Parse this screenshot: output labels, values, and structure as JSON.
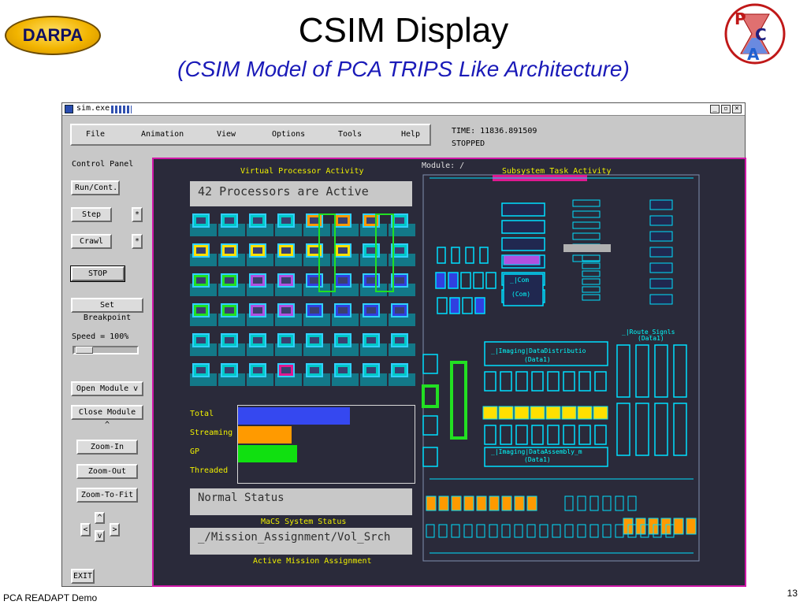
{
  "slide": {
    "darpa_logo_text": "DARPA",
    "title": "CSIM Display",
    "subtitle": "(CSIM Model of PCA TRIPS Like Architecture)",
    "footer": "PCA READAPT Demo",
    "page_number": "13",
    "pca_logo_letters": [
      "P",
      "C",
      "A"
    ]
  },
  "window": {
    "title": "sim.exe",
    "controls": [
      "_",
      "▫",
      "×"
    ]
  },
  "menu": {
    "items": [
      "File",
      "Animation",
      "View",
      "Options",
      "Tools",
      "Help"
    ]
  },
  "sim_status": {
    "time_line": "TIME: 11836.891509",
    "state": "STOPPED"
  },
  "control_panel": {
    "label": "Control Panel",
    "run": "Run/Cont.",
    "step": "Step",
    "step_mark": "*",
    "crawl": "Crawl",
    "crawl_mark": "*",
    "stop": "STOP",
    "set_breakpoint": "Set Breakpoint",
    "speed_label": "Speed = 100%",
    "speed_value": 100,
    "open_module": "Open Module  v",
    "close_module": "Close Module ^",
    "zoom_in": "Zoom-In",
    "zoom_out": "Zoom-Out",
    "zoom_to_fit": "Zoom-To-Fit",
    "arrow_up": "^",
    "arrow_left": "<",
    "arrow_down": "v",
    "arrow_right": ">",
    "exit": "EXIT"
  },
  "canvas": {
    "module_label": "Module:  /",
    "vp_heading": "Virtual Processor Activity",
    "active_processors": "42 Processors are Active",
    "subsystem_heading": "Subsystem Task Activity",
    "normal_status": "Normal Status",
    "macs_status_label": "MaCS System Status",
    "mission_path": "_/Mission_Assignment/Vol_Srch",
    "mission_label": "Active Mission Assignment",
    "activity_bars": [
      {
        "label": "Total",
        "color": "#3548f0",
        "relative_level": 0.63
      },
      {
        "label": "Streaming",
        "color": "#ff9a00",
        "relative_level": 0.3
      },
      {
        "label": "GP",
        "color": "#10e010",
        "relative_level": 0.33
      },
      {
        "label": "Threaded",
        "color": "#3548f0",
        "relative_level": 0
      }
    ],
    "subsystem_labels": {
      "imaging_distribution": "_|Imaging|DataDistributio",
      "imaging_distribution_sub": "(Data1)",
      "imaging_assembly": "_|Imaging|DataAssembly_m",
      "imaging_assembly_sub": "(Data1)",
      "com1": "_|Com",
      "com2": "(Com)",
      "route": "_|Route_Signls",
      "route_sub": "(Data1)"
    }
  }
}
